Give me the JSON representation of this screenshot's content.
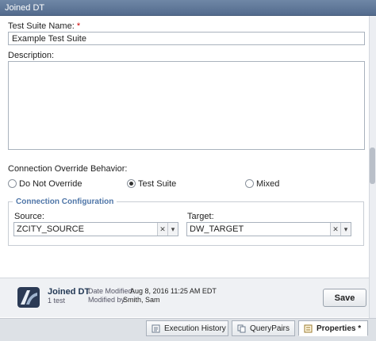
{
  "window": {
    "title": "Joined DT"
  },
  "form": {
    "name_label": "Test Suite Name:",
    "name_required_mark": "*",
    "name_value": "Example Test Suite",
    "description_label": "Description:",
    "description_value": "",
    "override_label": "Connection Override Behavior:",
    "override_options": [
      {
        "label": "Do Not Override",
        "selected": false
      },
      {
        "label": "Test Suite",
        "selected": true
      },
      {
        "label": "Mixed",
        "selected": false
      }
    ]
  },
  "connection": {
    "legend": "Connection Configuration",
    "source_label": "Source:",
    "source_value": "ZCITY_SOURCE",
    "target_label": "Target:",
    "target_value": "DW_TARGET",
    "clear_glyph": "✕",
    "dropdown_glyph": "▾"
  },
  "footer": {
    "name": "Joined DT",
    "count": "1 test",
    "date_modified_label": "Date Modified:",
    "date_modified_value": "Aug 8, 2016 11:25 AM EDT",
    "modified_by_label": "Modified by:",
    "modified_by_value": "Smith, Sam",
    "save_label": "Save"
  },
  "tabs": [
    {
      "label": "Execution History",
      "active": false
    },
    {
      "label": "QueryPairs",
      "active": false
    },
    {
      "label": "Properties *",
      "active": true
    }
  ],
  "colors": {
    "titlebar": "#5b7396",
    "legend": "#4f76a8",
    "footer_bg": "#eff1f4"
  }
}
